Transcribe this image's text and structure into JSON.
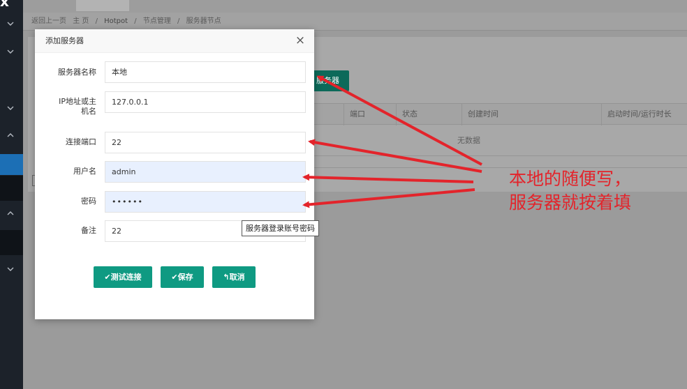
{
  "sidebar": {
    "logo": "x",
    "chevrons": [
      "chevron-down",
      "chevron-down",
      "chevron-down",
      "chevron-up",
      "chevron-up",
      "chevron-down"
    ]
  },
  "breadcrumb": {
    "back": "返回上一页",
    "home": "主 页",
    "sep": "/",
    "item1": "Hotpot",
    "item2": "节点管理",
    "item3": "服务器节点"
  },
  "toolbar": {
    "add_label": "服务器"
  },
  "table": {
    "headers": [
      "端口",
      "状态",
      "创建时间",
      "启动时间/运行时长"
    ],
    "empty_text": "无数据"
  },
  "modal": {
    "title": "添加服务器",
    "close": "×",
    "fields": {
      "name_label": "服务器名称",
      "name_value": "本地",
      "host_label": "IP地址或主机名",
      "host_value": "127.0.0.1",
      "port_label": "连接端口",
      "port_value": "22",
      "user_label": "用户名",
      "user_value": "admin",
      "pass_label": "密码",
      "pass_value": "••••••",
      "remark_label": "备注",
      "remark_value": "22"
    },
    "buttons": {
      "test": "✔测试连接",
      "save": "✔保存",
      "cancel": "↰取消"
    }
  },
  "tooltip": {
    "text": "服务器登录账号密码"
  },
  "annotation": {
    "line1": "本地的随便写，",
    "line2": "服务器就按着填",
    "color": "#e3242b"
  }
}
